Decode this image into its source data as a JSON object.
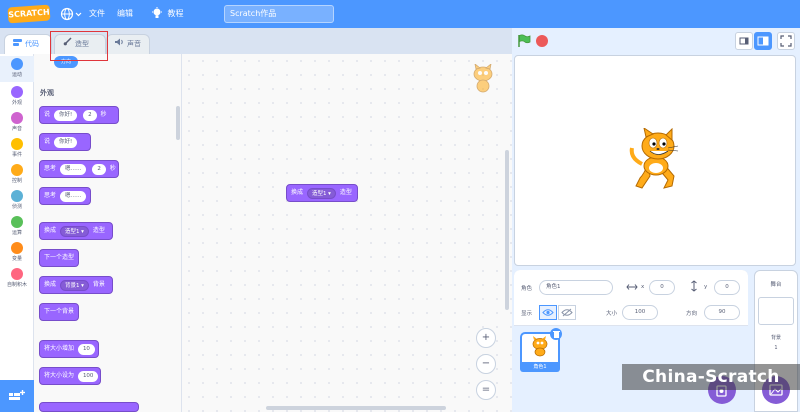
{
  "menubar": {
    "logo": "SCRATCH",
    "file": "文件",
    "edit": "编辑",
    "tips": "教程",
    "project_title": "Scratch作品"
  },
  "tabs": [
    {
      "label": "代码",
      "icon": "code-icon"
    },
    {
      "label": "造型",
      "icon": "brush-icon"
    },
    {
      "label": "声音",
      "icon": "speaker-icon"
    }
  ],
  "categories": [
    {
      "label": "运动",
      "color": "#4c97ff"
    },
    {
      "label": "外观",
      "color": "#9966ff"
    },
    {
      "label": "声音",
      "color": "#cf63cf"
    },
    {
      "label": "事件",
      "color": "#ffbf00"
    },
    {
      "label": "控制",
      "color": "#ffab19"
    },
    {
      "label": "侦测",
      "color": "#5cb1d6"
    },
    {
      "label": "运算",
      "color": "#59c059"
    },
    {
      "label": "变量",
      "color": "#ff8c1a"
    },
    {
      "label": "自制积木",
      "color": "#ff6680"
    }
  ],
  "palette": {
    "top_pill": "方向",
    "heading": "外观",
    "blocks": {
      "say_secs": {
        "pre": "说",
        "text": "你好!",
        "num": "2",
        "post": "秒"
      },
      "say": {
        "pre": "说",
        "text": "你好!"
      },
      "think_secs": {
        "pre": "思考",
        "text": "嗯……",
        "num": "2",
        "post": "秒"
      },
      "think": {
        "pre": "思考",
        "text": "嗯……"
      },
      "switch_costume": {
        "pre": "换成",
        "dd": "造型1",
        "post": "造型"
      },
      "next_costume": {
        "text": "下一个造型"
      },
      "switch_backdrop": {
        "pre": "换成",
        "dd": "背景1",
        "post": "背景"
      },
      "next_backdrop": {
        "text": "下一个背景"
      },
      "change_size": {
        "pre": "将大小增加",
        "num": "10"
      },
      "set_size": {
        "pre": "将大小设为",
        "num": "100"
      }
    }
  },
  "workspace": {
    "block": {
      "pre": "换成",
      "dd": "造型1",
      "post": "造型"
    },
    "zoom_in": "+",
    "zoom_out": "−",
    "zoom_reset": "="
  },
  "sprite_info": {
    "sprite_label": "角色",
    "sprite_name": "角色1",
    "x_label": "x",
    "x_value": "0",
    "y_label": "y",
    "y_value": "0",
    "show_label": "显示",
    "size_label": "大小",
    "size_value": "100",
    "direction_label": "方向",
    "direction_value": "90"
  },
  "sprite_list": {
    "thumb_label": "角色1"
  },
  "stage_pane": {
    "title": "舞台",
    "backdrop_label": "背景",
    "backdrop_count": "1"
  },
  "watermark": "China-Scratch",
  "colors": {
    "primary": "#4c97ff",
    "looks": "#9966ff",
    "highlight_border": "#e0353b"
  }
}
